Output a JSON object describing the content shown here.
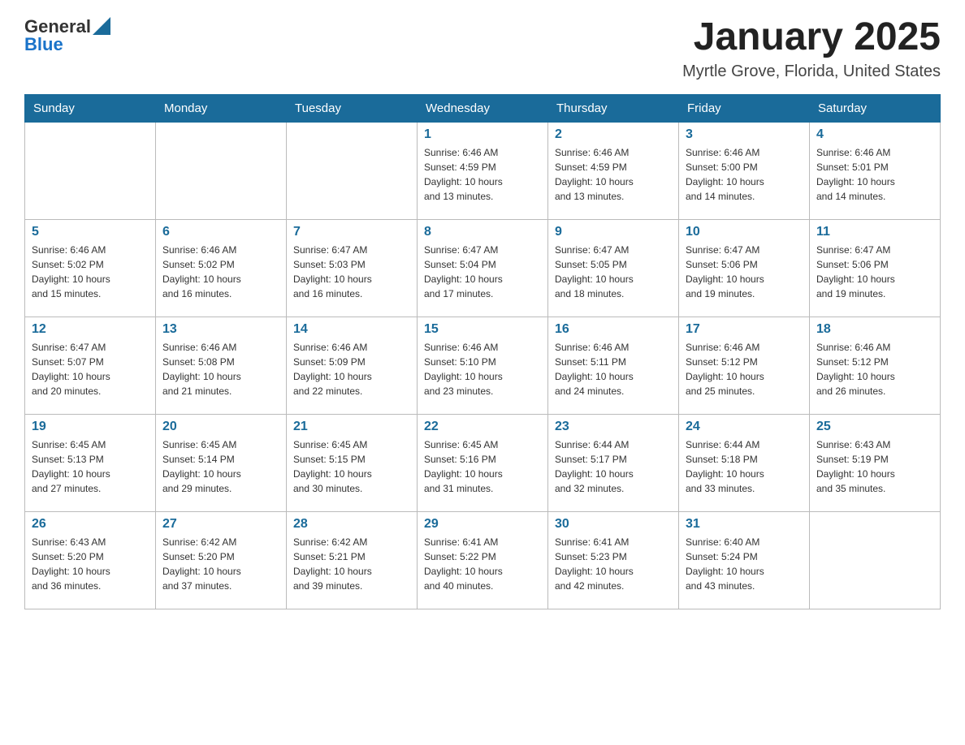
{
  "logo": {
    "general": "General",
    "blue": "Blue"
  },
  "header": {
    "title": "January 2025",
    "subtitle": "Myrtle Grove, Florida, United States"
  },
  "weekdays": [
    "Sunday",
    "Monday",
    "Tuesday",
    "Wednesday",
    "Thursday",
    "Friday",
    "Saturday"
  ],
  "rows": [
    [
      {
        "day": "",
        "info": ""
      },
      {
        "day": "",
        "info": ""
      },
      {
        "day": "",
        "info": ""
      },
      {
        "day": "1",
        "info": "Sunrise: 6:46 AM\nSunset: 4:59 PM\nDaylight: 10 hours\nand 13 minutes."
      },
      {
        "day": "2",
        "info": "Sunrise: 6:46 AM\nSunset: 4:59 PM\nDaylight: 10 hours\nand 13 minutes."
      },
      {
        "day": "3",
        "info": "Sunrise: 6:46 AM\nSunset: 5:00 PM\nDaylight: 10 hours\nand 14 minutes."
      },
      {
        "day": "4",
        "info": "Sunrise: 6:46 AM\nSunset: 5:01 PM\nDaylight: 10 hours\nand 14 minutes."
      }
    ],
    [
      {
        "day": "5",
        "info": "Sunrise: 6:46 AM\nSunset: 5:02 PM\nDaylight: 10 hours\nand 15 minutes."
      },
      {
        "day": "6",
        "info": "Sunrise: 6:46 AM\nSunset: 5:02 PM\nDaylight: 10 hours\nand 16 minutes."
      },
      {
        "day": "7",
        "info": "Sunrise: 6:47 AM\nSunset: 5:03 PM\nDaylight: 10 hours\nand 16 minutes."
      },
      {
        "day": "8",
        "info": "Sunrise: 6:47 AM\nSunset: 5:04 PM\nDaylight: 10 hours\nand 17 minutes."
      },
      {
        "day": "9",
        "info": "Sunrise: 6:47 AM\nSunset: 5:05 PM\nDaylight: 10 hours\nand 18 minutes."
      },
      {
        "day": "10",
        "info": "Sunrise: 6:47 AM\nSunset: 5:06 PM\nDaylight: 10 hours\nand 19 minutes."
      },
      {
        "day": "11",
        "info": "Sunrise: 6:47 AM\nSunset: 5:06 PM\nDaylight: 10 hours\nand 19 minutes."
      }
    ],
    [
      {
        "day": "12",
        "info": "Sunrise: 6:47 AM\nSunset: 5:07 PM\nDaylight: 10 hours\nand 20 minutes."
      },
      {
        "day": "13",
        "info": "Sunrise: 6:46 AM\nSunset: 5:08 PM\nDaylight: 10 hours\nand 21 minutes."
      },
      {
        "day": "14",
        "info": "Sunrise: 6:46 AM\nSunset: 5:09 PM\nDaylight: 10 hours\nand 22 minutes."
      },
      {
        "day": "15",
        "info": "Sunrise: 6:46 AM\nSunset: 5:10 PM\nDaylight: 10 hours\nand 23 minutes."
      },
      {
        "day": "16",
        "info": "Sunrise: 6:46 AM\nSunset: 5:11 PM\nDaylight: 10 hours\nand 24 minutes."
      },
      {
        "day": "17",
        "info": "Sunrise: 6:46 AM\nSunset: 5:12 PM\nDaylight: 10 hours\nand 25 minutes."
      },
      {
        "day": "18",
        "info": "Sunrise: 6:46 AM\nSunset: 5:12 PM\nDaylight: 10 hours\nand 26 minutes."
      }
    ],
    [
      {
        "day": "19",
        "info": "Sunrise: 6:45 AM\nSunset: 5:13 PM\nDaylight: 10 hours\nand 27 minutes."
      },
      {
        "day": "20",
        "info": "Sunrise: 6:45 AM\nSunset: 5:14 PM\nDaylight: 10 hours\nand 29 minutes."
      },
      {
        "day": "21",
        "info": "Sunrise: 6:45 AM\nSunset: 5:15 PM\nDaylight: 10 hours\nand 30 minutes."
      },
      {
        "day": "22",
        "info": "Sunrise: 6:45 AM\nSunset: 5:16 PM\nDaylight: 10 hours\nand 31 minutes."
      },
      {
        "day": "23",
        "info": "Sunrise: 6:44 AM\nSunset: 5:17 PM\nDaylight: 10 hours\nand 32 minutes."
      },
      {
        "day": "24",
        "info": "Sunrise: 6:44 AM\nSunset: 5:18 PM\nDaylight: 10 hours\nand 33 minutes."
      },
      {
        "day": "25",
        "info": "Sunrise: 6:43 AM\nSunset: 5:19 PM\nDaylight: 10 hours\nand 35 minutes."
      }
    ],
    [
      {
        "day": "26",
        "info": "Sunrise: 6:43 AM\nSunset: 5:20 PM\nDaylight: 10 hours\nand 36 minutes."
      },
      {
        "day": "27",
        "info": "Sunrise: 6:42 AM\nSunset: 5:20 PM\nDaylight: 10 hours\nand 37 minutes."
      },
      {
        "day": "28",
        "info": "Sunrise: 6:42 AM\nSunset: 5:21 PM\nDaylight: 10 hours\nand 39 minutes."
      },
      {
        "day": "29",
        "info": "Sunrise: 6:41 AM\nSunset: 5:22 PM\nDaylight: 10 hours\nand 40 minutes."
      },
      {
        "day": "30",
        "info": "Sunrise: 6:41 AM\nSunset: 5:23 PM\nDaylight: 10 hours\nand 42 minutes."
      },
      {
        "day": "31",
        "info": "Sunrise: 6:40 AM\nSunset: 5:24 PM\nDaylight: 10 hours\nand 43 minutes."
      },
      {
        "day": "",
        "info": ""
      }
    ]
  ]
}
